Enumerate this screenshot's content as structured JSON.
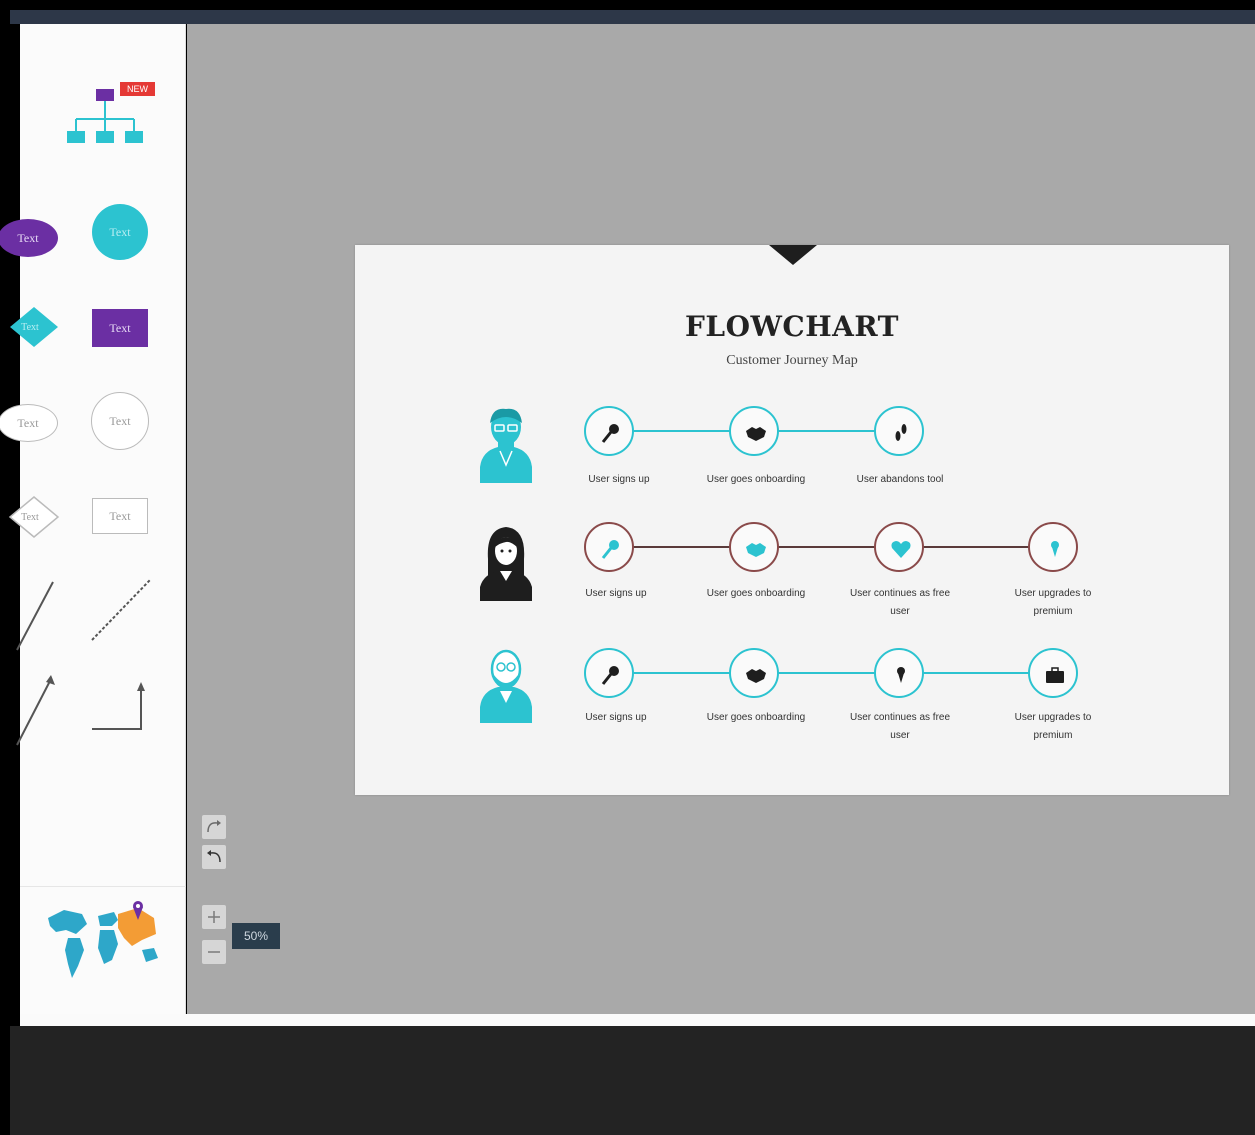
{
  "sidebar": {
    "new_badge": "NEW",
    "shapes": {
      "ellipse_label": "Text",
      "circle_label": "Text",
      "diamond_label": "Text",
      "rect_label": "Text",
      "outline_ellipse_label": "Text",
      "outline_circle_label": "Text",
      "outline_diamond_label": "Text",
      "outline_rect_label": "Text"
    }
  },
  "slide": {
    "title": "FLOWCHART",
    "subtitle": "Customer Journey Map",
    "rows": [
      {
        "persona": "teal-man-icon",
        "steps": [
          "User signs up",
          "User goes onboarding",
          "User abandons tool"
        ]
      },
      {
        "persona": "dark-woman-icon",
        "steps": [
          "User signs up",
          "User goes onboarding",
          "User continues as free user",
          "User upgrades to premium"
        ]
      },
      {
        "persona": "teal-bald-man-icon",
        "steps": [
          "User signs up",
          "User goes onboarding",
          "User continues as free user",
          "User upgrades to premium"
        ]
      }
    ]
  },
  "zoom": {
    "level": "50%"
  },
  "colors": {
    "accent": "#2cc3d0",
    "purple": "#6b2fa3",
    "canvas": "#a9a9a9",
    "badge": "#e53935"
  }
}
